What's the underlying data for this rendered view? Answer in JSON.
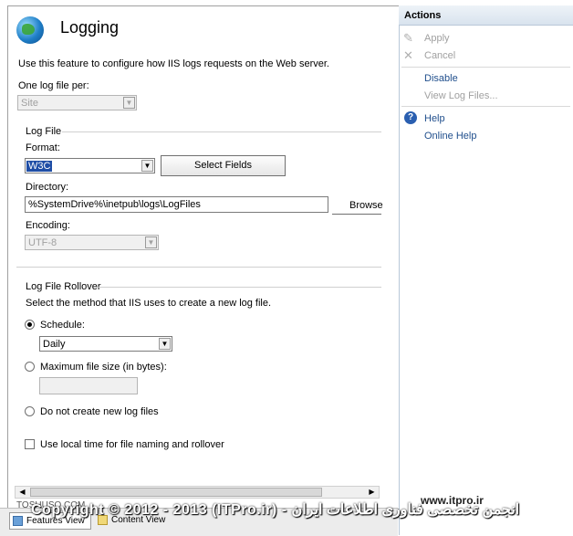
{
  "header": {
    "title": "Logging",
    "description": "Use this feature to configure how IIS logs requests on the Web server."
  },
  "one_log_file": {
    "label": "One log file per:",
    "value": "Site"
  },
  "log_file": {
    "group_label": "Log File",
    "format_label": "Format:",
    "format_value": "W3C",
    "select_fields_label": "Select Fields",
    "directory_label": "Directory:",
    "directory_value": "%SystemDrive%\\inetpub\\logs\\LogFiles",
    "browse_label": "Browse",
    "encoding_label": "Encoding:",
    "encoding_value": "UTF-8"
  },
  "rollover": {
    "group_label": "Log File Rollover",
    "description": "Select the method that IIS uses to create a new log file.",
    "schedule_label": "Schedule:",
    "schedule_value": "Daily",
    "max_size_label": "Maximum file size (in bytes):",
    "no_new_label": "Do not create new log files",
    "local_time_label": "Use local time for file naming and rollover"
  },
  "actions": {
    "title": "Actions",
    "apply": "Apply",
    "cancel": "Cancel",
    "disable": "Disable",
    "view_log_files": "View Log Files...",
    "help": "Help",
    "online_help": "Online Help"
  },
  "tabs": {
    "features_view": "Features View",
    "content_view": "Content View"
  },
  "overlay": {
    "watermark": "TOSHUSO.COM",
    "copyright": "Copyright © 2012 - 2013 (ITPro.ir) - انجمن تخصصی فناوری اطلاعات ایران",
    "site": "www.itpro.ir"
  },
  "colors": {
    "accent": "#1f4e8c",
    "selection": "#1f4ea6"
  }
}
